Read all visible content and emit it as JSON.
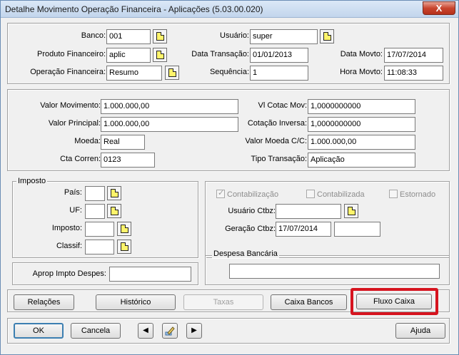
{
  "window": {
    "title": "Detalhe Movimento Operação Financeira - Aplicações (5.03.00.020)",
    "close_label": "X"
  },
  "header": {
    "banco_label": "Banco:",
    "banco_value": "001",
    "usuario_label": "Usuário:",
    "usuario_value": "super",
    "produto_label": "Produto Financeiro:",
    "produto_value": "aplic",
    "data_transacao_label": "Data Transação:",
    "data_transacao_value": "01/01/2013",
    "data_movto_label": "Data Movto:",
    "data_movto_value": "17/07/2014",
    "operacao_label": "Operação Financeira:",
    "operacao_value": "Resumo",
    "sequencia_label": "Sequência:",
    "sequencia_value": "1",
    "hora_movto_label": "Hora Movto:",
    "hora_movto_value": "11:08:33"
  },
  "values": {
    "valor_movimento_label": "Valor Movimento:",
    "valor_movimento_value": "1.000.000,00",
    "vl_cotac_label": "Vl Cotac Mov:",
    "vl_cotac_value": "1,0000000000",
    "valor_principal_label": "Valor Principal:",
    "valor_principal_value": "1.000.000,00",
    "cotacao_inversa_label": "Cotação Inversa:",
    "cotacao_inversa_value": "1,0000000000",
    "moeda_label": "Moeda:",
    "moeda_value": "Real",
    "valor_moeda_label": "Valor Moeda C/C:",
    "valor_moeda_value": "1.000.000,00",
    "cta_corren_label": "Cta Corren:",
    "cta_corren_value": "0123",
    "tipo_transacao_label": "Tipo Transação:",
    "tipo_transacao_value": "Aplicação"
  },
  "imposto": {
    "group_title": "Imposto",
    "pais_label": "País:",
    "pais_value": "",
    "uf_label": "UF:",
    "uf_value": "",
    "imposto_label": "Imposto:",
    "imposto_value": "",
    "classif_label": "Classif:",
    "classif_value": "",
    "aprop_label": "Aprop Impto Despes:",
    "aprop_value": ""
  },
  "contab": {
    "contabilizacao_label": "Contabilização",
    "contabilizada_label": "Contabilizada",
    "estornado_label": "Estornado",
    "usuario_ctbz_label": "Usuário Ctbz:",
    "usuario_ctbz_value": "",
    "geracao_ctbz_label": "Geração Ctbz:",
    "geracao_ctbz_value": "17/07/2014",
    "geracao_ctbz_extra": ""
  },
  "despesa": {
    "group_title": "Despesa Bancária",
    "value": ""
  },
  "actions": {
    "relacoes": "Relações",
    "historico": "Histórico",
    "taxas": "Taxas",
    "caixa_bancos": "Caixa Bancos",
    "fluxo_caixa": "Fluxo Caixa"
  },
  "footer": {
    "ok": "OK",
    "cancela": "Cancela",
    "ajuda": "Ajuda",
    "prev_symbol": "◀",
    "next_symbol": "▶"
  },
  "colors": {
    "highlight": "#d6141f",
    "note_icon": "#fff46b"
  }
}
